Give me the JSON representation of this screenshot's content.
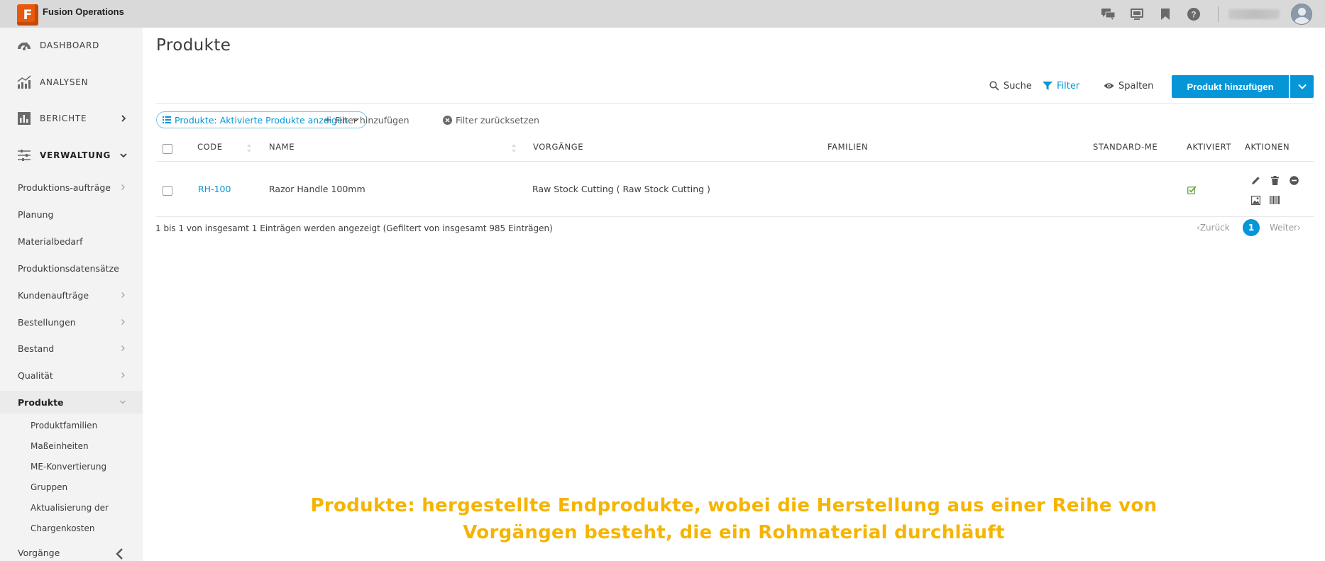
{
  "app": {
    "logo_letter": "F",
    "title": "Fusion Operations"
  },
  "topbar": {
    "icons": [
      "chat-icon",
      "screen-icon",
      "bookmark-icon",
      "help-icon"
    ],
    "user_name": "",
    "avatar": "avatar"
  },
  "sidebar": {
    "main_items": [
      {
        "label": "DASHBOARD",
        "icon": "dashboard-icon"
      },
      {
        "label": "ANALYSEN",
        "icon": "analytics-icon"
      },
      {
        "label": "BERICHTE",
        "icon": "reports-icon"
      },
      {
        "label": "VERWALTUNG",
        "icon": "settings-sliders-icon"
      }
    ],
    "sub_items": [
      {
        "label": "Produktions-aufträge"
      },
      {
        "label": "Planung"
      },
      {
        "label": "Materialbedarf"
      },
      {
        "label": "Produktionsdatensätze"
      },
      {
        "label": "Kundenaufträge"
      },
      {
        "label": "Bestellungen"
      },
      {
        "label": "Bestand"
      },
      {
        "label": "Qualität"
      },
      {
        "label": "Produkte"
      }
    ],
    "product_children": [
      {
        "label": "Produktfamilien"
      },
      {
        "label": "Maßeinheiten"
      },
      {
        "label": "ME-Konvertierung"
      },
      {
        "label": "Gruppen"
      },
      {
        "label": "Aktualisierung der"
      },
      {
        "label": "Chargenkosten"
      }
    ],
    "last_item": "Vorgänge"
  },
  "page": {
    "title": "Produkte",
    "toolbar": {
      "search": "Suche",
      "filter": "Filter",
      "columns": "Spalten",
      "add_button": "Produkt hinzufügen"
    },
    "filters": {
      "active_chip": "Produkte: Aktivierte Produkte anzeigen",
      "add_filter": "Filter hinzufügen",
      "reset_filter": "Filter zurücksetzen"
    },
    "table": {
      "headers": [
        "CODE",
        "NAME",
        "VORGÄNGE",
        "FAMILIEN",
        "STANDARD-ME",
        "AKTIVIERT",
        "AKTIONEN"
      ],
      "rows": [
        {
          "code": "RH-100",
          "name": "Razor Handle 100mm",
          "operations": "Raw Stock Cutting ( Raw Stock Cutting )",
          "families": "",
          "default_uom": "",
          "activated": true
        }
      ],
      "row_actions": [
        "edit-icon",
        "delete-icon",
        "deactivate-icon",
        "image-icon",
        "barcode-icon"
      ]
    },
    "pagination": {
      "info": "1 bis 1 von insgesamt 1 Einträgen werden angezeigt (Gefiltert von insgesamt 985 Einträgen)",
      "prev": "Zurück",
      "current": "1",
      "next": "Weiter"
    }
  },
  "caption": {
    "line1": "Produkte: hergestellte Endprodukte, wobei die Herstellung aus einer Reihe von",
    "line2": "Vorgängen besteht, die ein Rohmaterial durchläuft"
  },
  "colors": {
    "accent": "#0696d7",
    "caption": "#f5b400",
    "logo": "#e8590c",
    "check": "#6aa84f"
  }
}
